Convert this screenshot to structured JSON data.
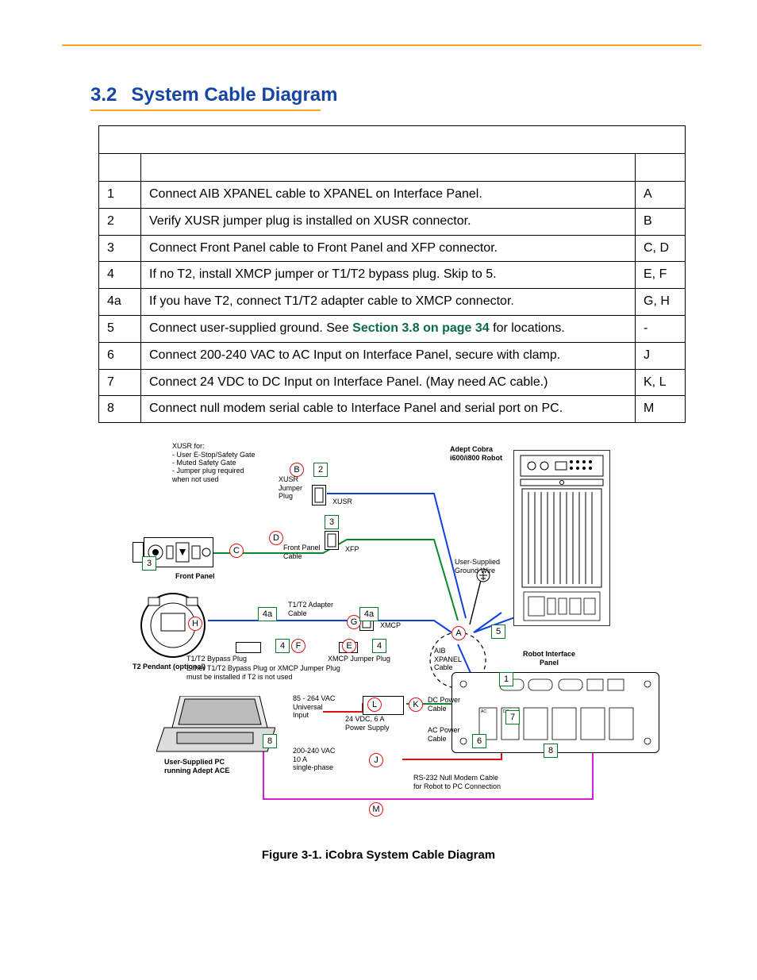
{
  "heading": {
    "number": "3.2",
    "title": "System Cable Diagram"
  },
  "steps": [
    {
      "num": "1",
      "desc": "Connect AIB XPANEL cable to XPANEL on Interface Panel.",
      "ref": "A"
    },
    {
      "num": "2",
      "desc": "Verify XUSR jumper plug is installed on XUSR connector.",
      "ref": "B"
    },
    {
      "num": "3",
      "desc": "Connect Front Panel cable to Front Panel and XFP connector.",
      "ref": "C, D"
    },
    {
      "num": "4",
      "desc": "If no T2, install XMCP jumper or T1/T2 bypass plug. Skip to 5.",
      "ref": "E, F"
    },
    {
      "num": "4a",
      "desc": "If you have T2, connect T1/T2 adapter cable to XMCP connector.",
      "ref": "G, H"
    },
    {
      "num": "5",
      "desc_pre": "Connect user-supplied ground. See ",
      "link": "Section 3.8 on page 34",
      "desc_post": " for locations.",
      "ref": "-"
    },
    {
      "num": "6",
      "desc": "Connect 200-240 VAC to AC Input on Interface Panel, secure with clamp.",
      "ref": "J"
    },
    {
      "num": "7",
      "desc": "Connect 24 VDC to DC Input on Interface Panel. (May need AC cable.)",
      "ref": "K, L"
    },
    {
      "num": "8",
      "desc": "Connect null modem serial cable to Interface Panel and serial port on PC.",
      "ref": "M"
    }
  ],
  "figure_caption": "Figure 3-1. iCobra System Cable Diagram",
  "diagram_labels": {
    "xusr_note_title": "XUSR for:",
    "xusr_note_l1": "- User E-Stop/Safety Gate",
    "xusr_note_l2": "- Muted Safety Gate",
    "xusr_note_l3": "- Jumper plug required",
    "xusr_note_l4": "  when not used",
    "xusr_jumper_plug": "XUSR\nJumper\nPlug",
    "xusr": "XUSR",
    "front_panel": "Front Panel",
    "front_panel_cable": "Front Panel\nCable",
    "xfp": "XFP",
    "t2_pendant": "T2 Pendant (optional)",
    "t1t2_adapter": "T1/T2 Adapter\nCable",
    "xmcp": "XMCP",
    "t1t2_bypass": "T1/T2 Bypass Plug",
    "xmcp_jumper": "XMCP Jumper Plug",
    "t1t2_note": "Either T1/T2 Bypass Plug or XMCP Jumper Plug\nmust be installed if T2 is not used",
    "aib_xpanel": "AIB\nXPANEL\nCable",
    "user_gnd": "User-Supplied\nGround Wire",
    "robot_title": "Adept Cobra\ni600/i800 Robot",
    "robot_iface": "Robot Interface\nPanel",
    "pc_title": "User-Supplied PC\nrunning Adept ACE",
    "vac_input": "85 - 264 VAC\nUniversal\nInput",
    "psu_label": "24 VDC, 6 A\nPower Supply",
    "dc_power": "DC Power\nCable",
    "ac_power": "AC Power\nCable",
    "vac_spec": "200-240 VAC\n10 A\nsingle-phase",
    "rs232": "RS-232 Null Modem Cable\nfor Robot to PC Connection"
  },
  "callouts": {
    "circles": [
      "A",
      "B",
      "C",
      "D",
      "E",
      "F",
      "G",
      "H",
      "J",
      "K",
      "L",
      "M"
    ],
    "squares": [
      "1",
      "2",
      "3",
      "3",
      "4",
      "4",
      "4a",
      "4a",
      "5",
      "6",
      "7",
      "8",
      "8"
    ]
  }
}
